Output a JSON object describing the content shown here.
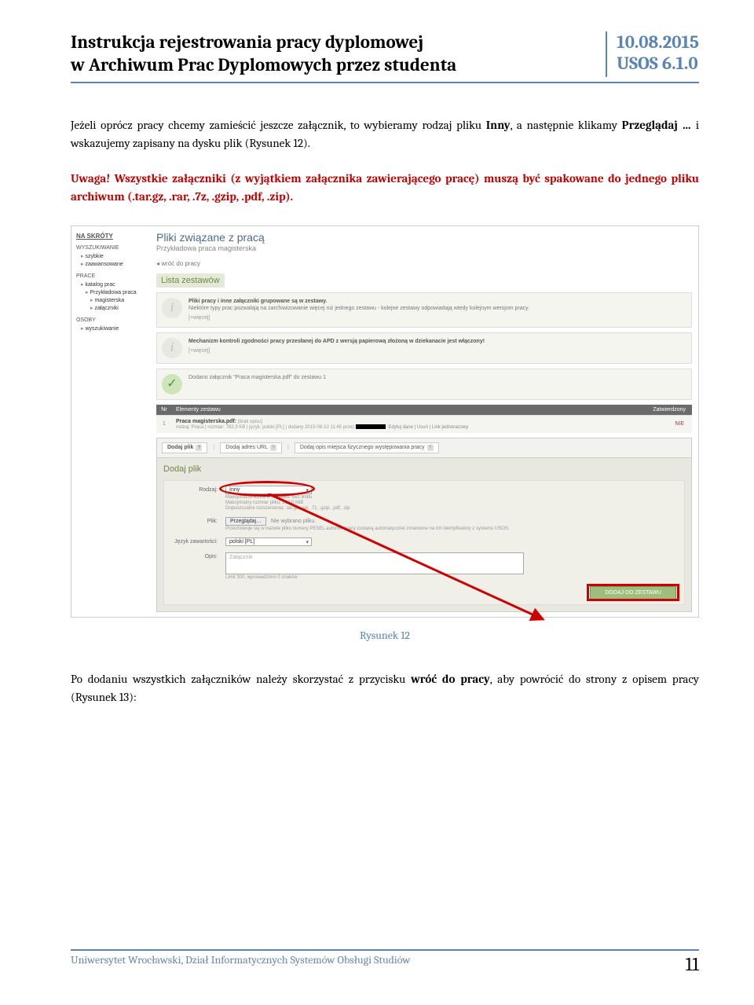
{
  "header": {
    "title_l1": "Instrukcja rejestrowania pracy dyplomowej",
    "title_l2": "w Archiwum Prac Dyplomowych przez studenta",
    "date": "10.08.2015",
    "version": "USOS 6.1.0"
  },
  "body": {
    "para1_pre": "Jeżeli oprócz pracy chcemy zamieścić jeszcze załącznik, to wybieramy rodzaj pliku ",
    "para1_b1": "Inny",
    "para1_mid": ", a następnie klikamy ",
    "para1_b2": "Przeglądaj …",
    "para1_post": " i wskazujemy zapisany na dysku plik (Rysunek 12).",
    "warn_uwaga": "Uwaga!",
    "warn_text": " Wszystkie załączniki (z wyjątkiem załącznika zawierającego pracę) muszą być spakowane do jednego pliku archiwum (.tar.gz, .rar, .7z, .gzip, .pdf, .zip).",
    "para2_pre": "Po dodaniu wszystkich załączników należy skorzystać z przycisku ",
    "para2_b": "wróć do pracy",
    "para2_post": ", aby powrócić do strony z opisem pracy (Rysunek 13):"
  },
  "caption": "Rysunek 12",
  "screenshot": {
    "sidebar": {
      "na_skroty": "NA SKRÓTY",
      "wyszukiwanie": "WYSZUKIWANIE",
      "szybkie": "szybkie",
      "zaawansowane": "zaawansowane",
      "prace": "PRACE",
      "katalog": "katalog prac",
      "przykladowa1": "Przykładowa praca",
      "przykladowa2": "magisterska",
      "zalaczniki": "załączniki",
      "osoby": "OSOBY",
      "wyszuk": "wyszukiwanie"
    },
    "main": {
      "h1": "Pliki związane z pracą",
      "h2": "Przykładowa praca magisterska",
      "back": "wróć do pracy",
      "lista": "Lista zestawów",
      "info1_l1": "Pliki pracy i inne załączniki grupowane są w zestawy.",
      "info1_l2": "Niektóre typy prac pozwalają na zarchiwizowanie więcej niż jednego zestawu - kolejne zestawy odpowiadają wtedy kolejnym wersjom pracy.",
      "info1_more": "[+więcej]",
      "info2_l1": "Mechanizm kontroli zgodności pracy przesłanej do APD z wersją papierową złożoną w dziekanacie jest włączony!",
      "info2_more": "[+więcej]",
      "info3": "Dodano załącznik \"Praca magisterska.pdf\" do zestawu 1",
      "th_nr": "Nr",
      "th_el": "Elementy zestawu",
      "th_zat": "Zatwierdzony",
      "row_nr": "1",
      "row_fn": "Praca magisterska.pdf:",
      "row_fn2": "[brak opisu]",
      "row_meta1": "rodzaj: Praca | rozmiar: 782,3 KB | język: polski [PL] | dodany 2015-08-10 11:45 przez",
      "row_meta2": "Edytuj dane | Usuń | Link jednorazowy",
      "row_zat": "NIE",
      "tab1": "Dodaj plik",
      "tab2": "Dodaj adres URL",
      "tab3": "Dodaj opis miejsca fizycznego występowania pracy",
      "panel_h": "Dodaj plik",
      "f_rodzaj": "Rodzaj:",
      "f_rodzaj_val": "Inny",
      "f_rodzaj_h1": "Maksymalna liczba w zestawie: bez limitu",
      "f_rodzaj_h2": "Maksymalny rozmiar pliku: 200,0 MiB",
      "f_rodzaj_h3": "Dopuszczalne rozszerzenia: .tar.gz, .rar, .7z, .gzip, .pdf, .zip",
      "f_plik": "Plik:",
      "f_plik_btn": "Przeglądaj…",
      "f_plik_txt": "Nie wybrano pliku.",
      "f_plik_h": "Przechowuje się w nazwie pliku numery PESEL autorów pracy zostaną automatycznie zmienione na ich identyfikatory z systemu USOS.",
      "f_jezyk": "Język zawartości:",
      "f_jezyk_val": "polski [PL]",
      "f_opis": "Opis:",
      "f_opis_ph": "Załącznik",
      "f_opis_h": "Limit 300, wprowadzono 0 znaków",
      "submit": "DODAJ DO ZESTAWU"
    }
  },
  "footer": {
    "text": "Uniwersytet Wrocławski, Dział Informatycznych Systemów Obsługi Studiów",
    "page": "11"
  }
}
